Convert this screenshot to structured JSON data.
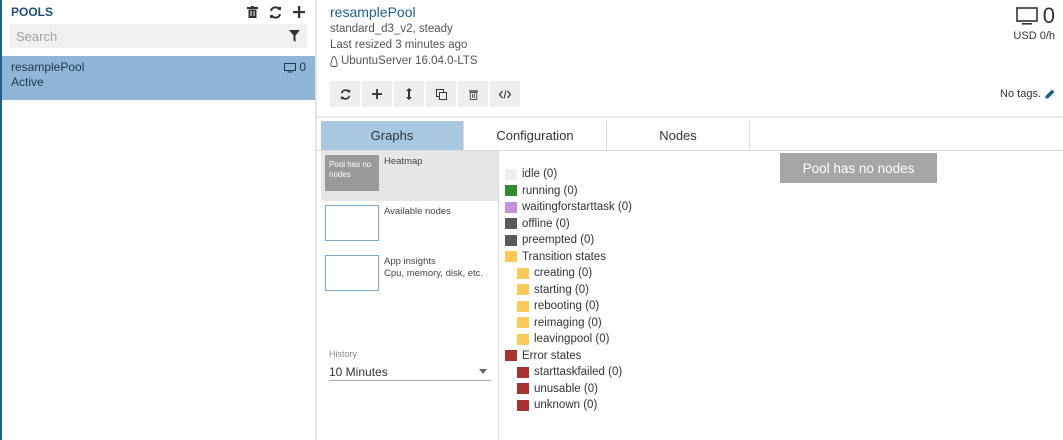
{
  "sidebar": {
    "title": "POOLS",
    "search_placeholder": "Search",
    "pools": [
      {
        "name": "resamplePool",
        "state": "Active",
        "node_count": "0"
      }
    ]
  },
  "pool": {
    "name": "resamplePool",
    "vm_info": "standard_d3_v2, steady",
    "resized": "Last resized 3 minutes ago",
    "os": "UbuntuServer 16.04.0-LTS",
    "node_count": "0",
    "cost": "USD 0/h",
    "tags": "No tags."
  },
  "tabs": [
    "Graphs",
    "Configuration",
    "Nodes"
  ],
  "graphs": {
    "heatmap_thumb": "Pool has no nodes",
    "heatmap_label": "Heatmap",
    "available_label": "Available nodes",
    "insights_label": "App insights",
    "insights_sub": "Cpu, memory, disk, etc.",
    "history_label": "History",
    "history_value": "10 Minutes",
    "no_nodes": "Pool has no nodes"
  },
  "legend": [
    {
      "label": "idle (0)",
      "color": "#eeeef2",
      "indent": false
    },
    {
      "label": "running (0)",
      "color": "#2e8b2e",
      "indent": false
    },
    {
      "label": "waitingforstarttask (0)",
      "color": "#c691d6",
      "indent": false
    },
    {
      "label": "offline (0)",
      "color": "#5a5a5a",
      "indent": false
    },
    {
      "label": "preempted (0)",
      "color": "#5a5a5a",
      "indent": false
    },
    {
      "label": "Transition states",
      "color": "#ffc857",
      "indent": false
    },
    {
      "label": "creating (0)",
      "color": "#ffc857",
      "indent": true
    },
    {
      "label": "starting (0)",
      "color": "#ffc857",
      "indent": true
    },
    {
      "label": "rebooting (0)",
      "color": "#ffc857",
      "indent": true
    },
    {
      "label": "reimaging (0)",
      "color": "#ffc857",
      "indent": true
    },
    {
      "label": "leavingpool (0)",
      "color": "#ffc857",
      "indent": true
    },
    {
      "label": "Error states",
      "color": "#a83232",
      "indent": false
    },
    {
      "label": "starttaskfailed (0)",
      "color": "#a83232",
      "indent": true
    },
    {
      "label": "unusable (0)",
      "color": "#a83232",
      "indent": true
    },
    {
      "label": "unknown (0)",
      "color": "#a83232",
      "indent": true
    }
  ]
}
